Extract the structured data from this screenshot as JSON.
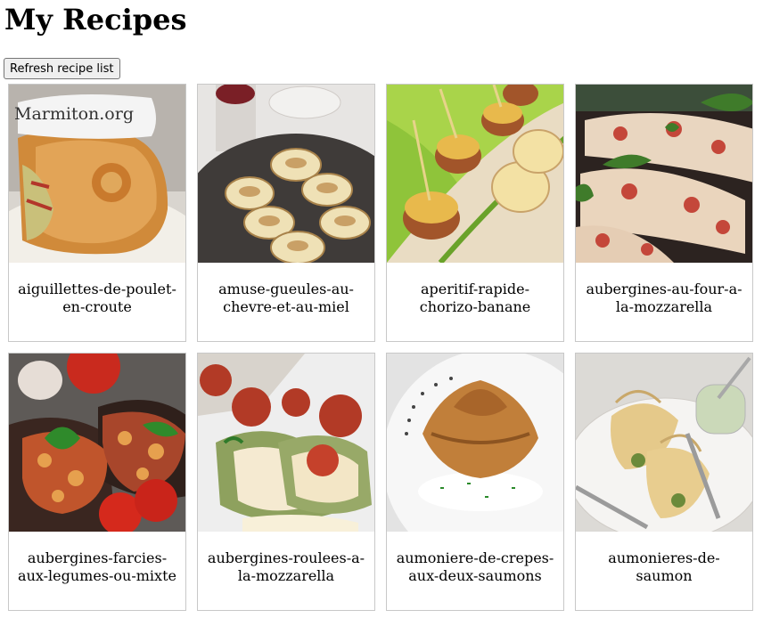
{
  "page": {
    "title": "My Recipes",
    "refresh_label": "Refresh recipe list"
  },
  "recipes": [
    {
      "name": "aiguillettes-de-poulet-en-croute",
      "label": "aiguillettes-de-poulet-en-croute",
      "watermark": "Marmiton.org"
    },
    {
      "name": "amuse-gueules-au-chevre-et-au-miel",
      "label": "amuse-gueules-au-chevre-et-au-miel"
    },
    {
      "name": "aperitif-rapide-chorizo-banane",
      "label": "aperitif-rapide-chorizo-banane"
    },
    {
      "name": "aubergines-au-four-a-la-mozzarella",
      "label": "aubergines-au-four-a-la-mozzarella"
    },
    {
      "name": "aubergines-farcies-aux-legumes-ou-mixte",
      "label": "aubergines-farcies-aux-legumes-ou-mixte"
    },
    {
      "name": "aubergines-roulees-a-la-mozzarella",
      "label": "aubergines-roulees-a-la-mozzarella"
    },
    {
      "name": "aumoniere-de-crepes-aux-deux-saumons",
      "label": "aumoniere-de-crepes-aux-deux-saumons"
    },
    {
      "name": "aumonieres-de-saumon",
      "label": "aumonieres-de-saumon"
    }
  ]
}
